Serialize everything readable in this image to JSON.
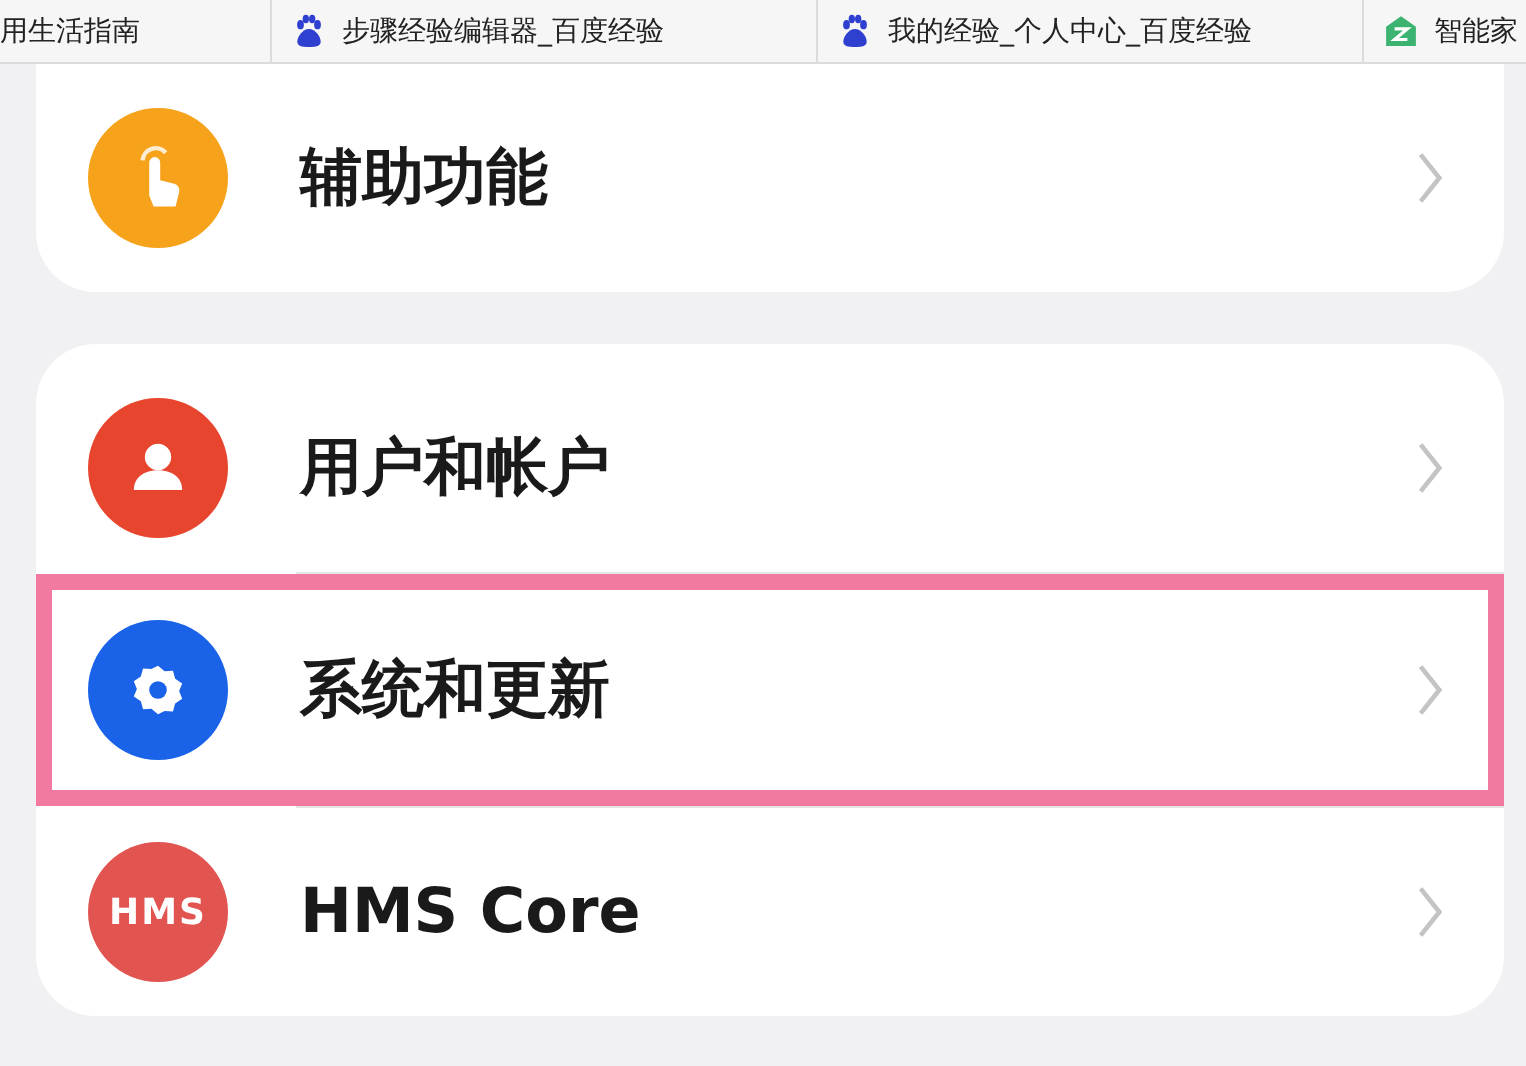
{
  "bookmarks": [
    {
      "label": "用生活指南",
      "kind": "plain"
    },
    {
      "label": "步骤经验编辑器_百度经验",
      "kind": "paw"
    },
    {
      "label": "我的经验_个人中心_百度经验",
      "kind": "paw"
    },
    {
      "label": "智能家",
      "kind": "house"
    }
  ],
  "groups": [
    {
      "items": [
        {
          "label": "辅助功能",
          "kind": "hand",
          "highlighted": false
        }
      ]
    },
    {
      "items": [
        {
          "label": "用户和帐户",
          "kind": "user",
          "highlighted": false
        },
        {
          "label": "系统和更新",
          "kind": "gear",
          "highlighted": true
        },
        {
          "label": "HMS Core",
          "kind": "hms",
          "icon_text": "HMS",
          "highlighted": false
        }
      ]
    }
  ]
}
